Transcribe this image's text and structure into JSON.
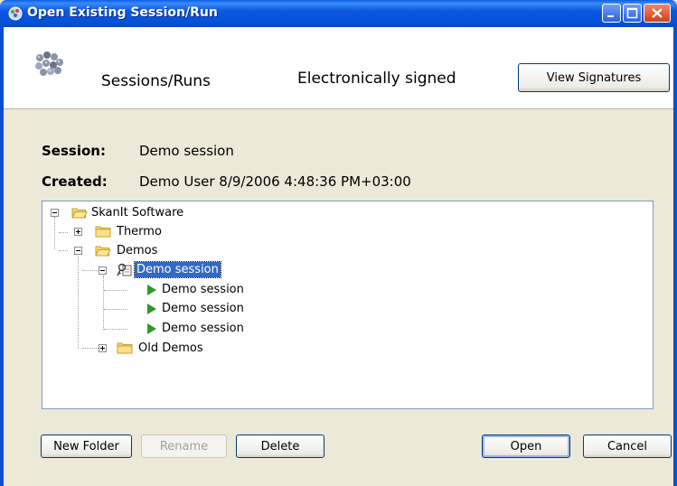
{
  "window": {
    "title": "Open Existing Session/Run"
  },
  "header": {
    "sessions_label": "Sessions/Runs",
    "signed_label": "Electronically signed",
    "view_signatures": "View Signatures"
  },
  "info": {
    "session_label": "Session:",
    "session_value": "Demo session",
    "created_label": "Created:",
    "created_value": "Demo User  8/9/2006 4:48:36 PM+03:00"
  },
  "tree": {
    "root": "SkanIt Software",
    "thermo": "Thermo",
    "demos": "Demos",
    "demo_session": "Demo session",
    "runs": [
      "Demo session",
      "Demo session",
      "Demo session"
    ],
    "old_demos": "Old Demos"
  },
  "buttons": {
    "new_folder": "New Folder",
    "rename": "Rename",
    "delete": "Delete",
    "open": "Open",
    "cancel": "Cancel"
  },
  "colors": {
    "title_bar": "#0A5FE8",
    "dialog_bg": "#ECE9D8",
    "selection": "#316AC5",
    "run_icon": "#2E9A2E"
  }
}
